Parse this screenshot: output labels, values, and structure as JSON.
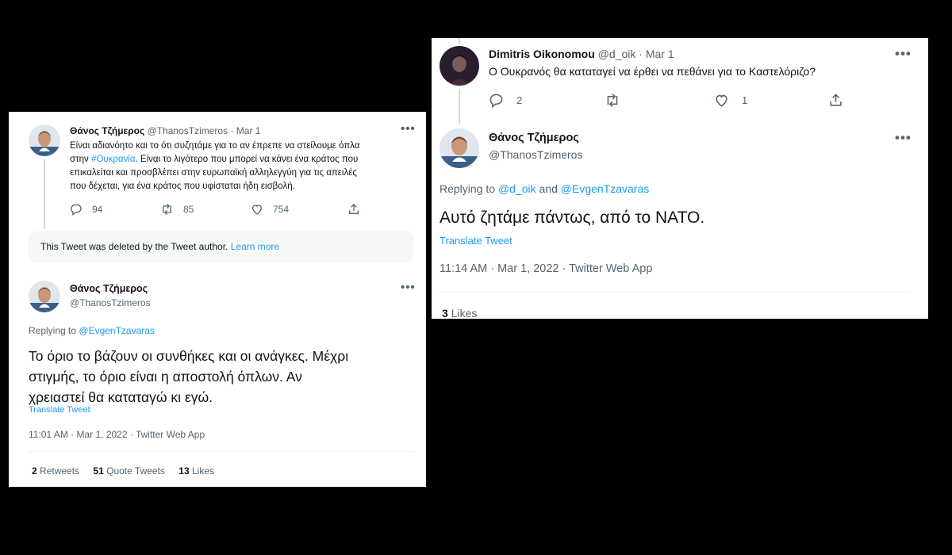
{
  "left": {
    "tweet1": {
      "name": "Θάνος Τζήμερος",
      "handle": "@ThanosTzimeros",
      "sep": "·",
      "date": "Mar 1",
      "line1": "Είναι αδιανόητο και το ότι συζητάμε για το αν έπρεπε να στείλουμε όπλα",
      "line2_pre": "στην ",
      "line2_hashtag": "#Ουκρανία",
      "line2_post": ". Είναι το λιγότερο που μπορεί να κάνει ένα κράτος που",
      "line3": "επικαλείται και προσβλέπει στην ευρωπαϊκή αλληλεγγύη για τις απειλές",
      "line4": "που δέχεται, για ένα κράτος που υφίσταται ήδη εισβολή.",
      "replies": "94",
      "retweets": "85",
      "likes": "754"
    },
    "deleted": {
      "text": "This Tweet was deleted by the Tweet author.",
      "link": "Learn more"
    },
    "tweet2": {
      "name": "Θάνος Τζήμερος",
      "handle": "@ThanosTzimeros",
      "replying_prefix": "Replying to",
      "replying_to": "@EvgenTzavaras",
      "line1": "Το όριο το βάζουν οι συνθήκες και οι ανάγκες. Μέχρι",
      "line2": "στιγμής, το όριο είναι η αποστολή όπλων. Αν",
      "line3": "χρειαστεί θα καταταγώ κι εγώ.",
      "translate": "Translate Tweet",
      "timestamp": "11:01 AM · Mar 1, 2022 · Twitter Web App",
      "retweets_count": "2",
      "retweets_label": "Retweets",
      "quotes_count": "51",
      "quotes_label": "Quote Tweets",
      "likes_count": "13",
      "likes_label": "Likes"
    }
  },
  "right": {
    "tweet1": {
      "name": "Dimitris Oikonomou",
      "handle": "@d_oik",
      "sep": "·",
      "date": "Mar 1",
      "text": "Ο Ουκρανός θα καταταγεί να έρθει να πεθάνει για το Καστελόριζο?",
      "replies": "2",
      "likes": "1"
    },
    "tweet2": {
      "name": "Θάνος Τζήμερος",
      "handle": "@ThanosTzimeros",
      "replying_prefix": "Replying to",
      "reply_to_1": "@d_oik",
      "reply_and": "and",
      "reply_to_2": "@EvgenTzavaras",
      "text": "Αυτό ζητάμε πάντως, από το ΝΑΤΟ.",
      "translate": "Translate Tweet",
      "timestamp": "11:14 AM · Mar 1, 2022 · Twitter Web App",
      "likes_count": "3",
      "likes_label": "Likes"
    }
  },
  "icons": {
    "reply": "reply-icon",
    "retweet": "retweet-icon",
    "like": "like-icon",
    "share": "share-icon",
    "more": "more-icon"
  },
  "colors": {
    "link": "#1d9bf0",
    "muted": "#536471",
    "text": "#0f1419"
  }
}
